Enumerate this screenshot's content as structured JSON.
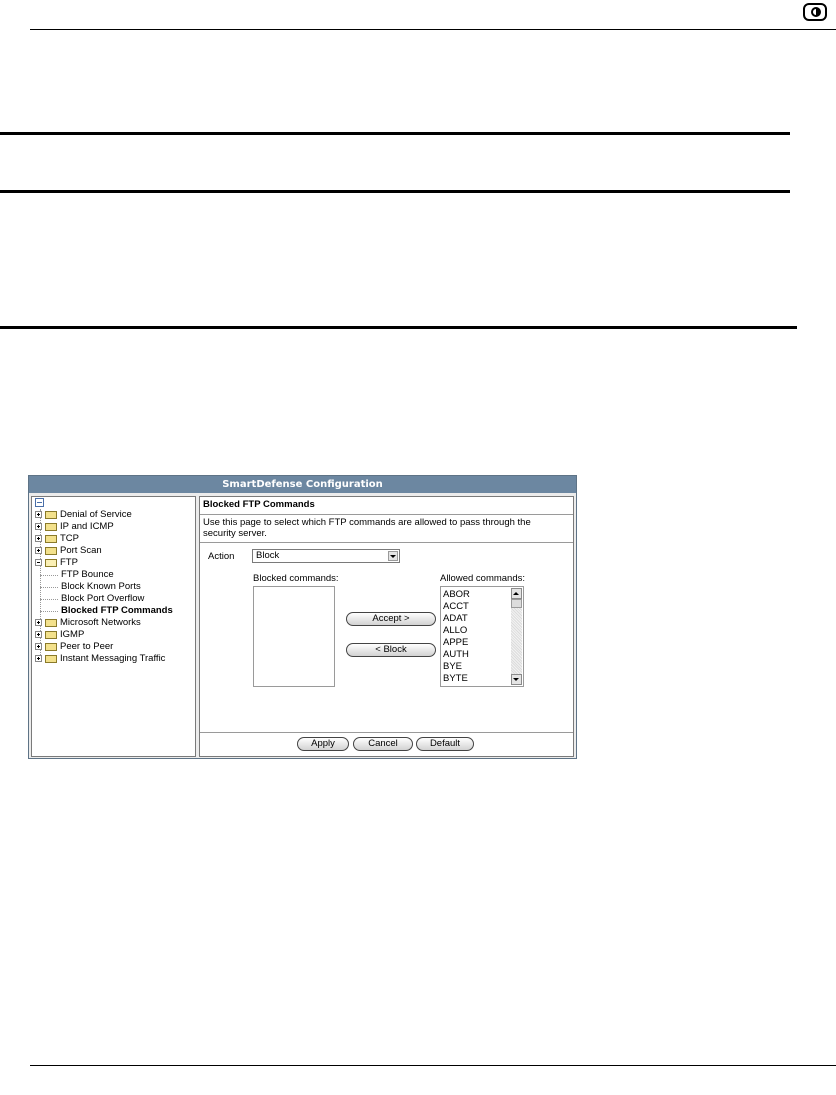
{
  "dialog": {
    "title": "SmartDefense Configuration",
    "tree": {
      "items": [
        {
          "label": "Denial of Service",
          "expanded": false
        },
        {
          "label": "IP and ICMP",
          "expanded": false
        },
        {
          "label": "TCP",
          "expanded": false
        },
        {
          "label": "Port Scan",
          "expanded": false
        },
        {
          "label": "FTP",
          "expanded": true
        },
        {
          "label": "Microsoft Networks",
          "expanded": false
        },
        {
          "label": "IGMP",
          "expanded": false
        },
        {
          "label": "Peer to Peer",
          "expanded": false
        },
        {
          "label": "Instant Messaging Traffic",
          "expanded": false
        }
      ],
      "ftp_children": [
        {
          "label": "FTP Bounce"
        },
        {
          "label": "Block Known Ports"
        },
        {
          "label": "Block Port Overflow"
        },
        {
          "label": "Blocked FTP Commands",
          "selected": true
        }
      ]
    },
    "content": {
      "title": "Blocked FTP Commands",
      "description": "Use this page to select which FTP commands are allowed to pass through the security server.",
      "action_label": "Action",
      "action_value": "Block",
      "blocked_label": "Blocked commands:",
      "allowed_label": "Allowed commands:",
      "blocked_commands": [],
      "allowed_commands": [
        "ABOR",
        "ACCT",
        "ADAT",
        "ALLO",
        "APPE",
        "AUTH",
        "BYE",
        "BYTE"
      ],
      "accept_button": "Accept >",
      "block_button": "< Block"
    },
    "footer": {
      "apply": "Apply",
      "cancel": "Cancel",
      "default": "Default"
    }
  }
}
